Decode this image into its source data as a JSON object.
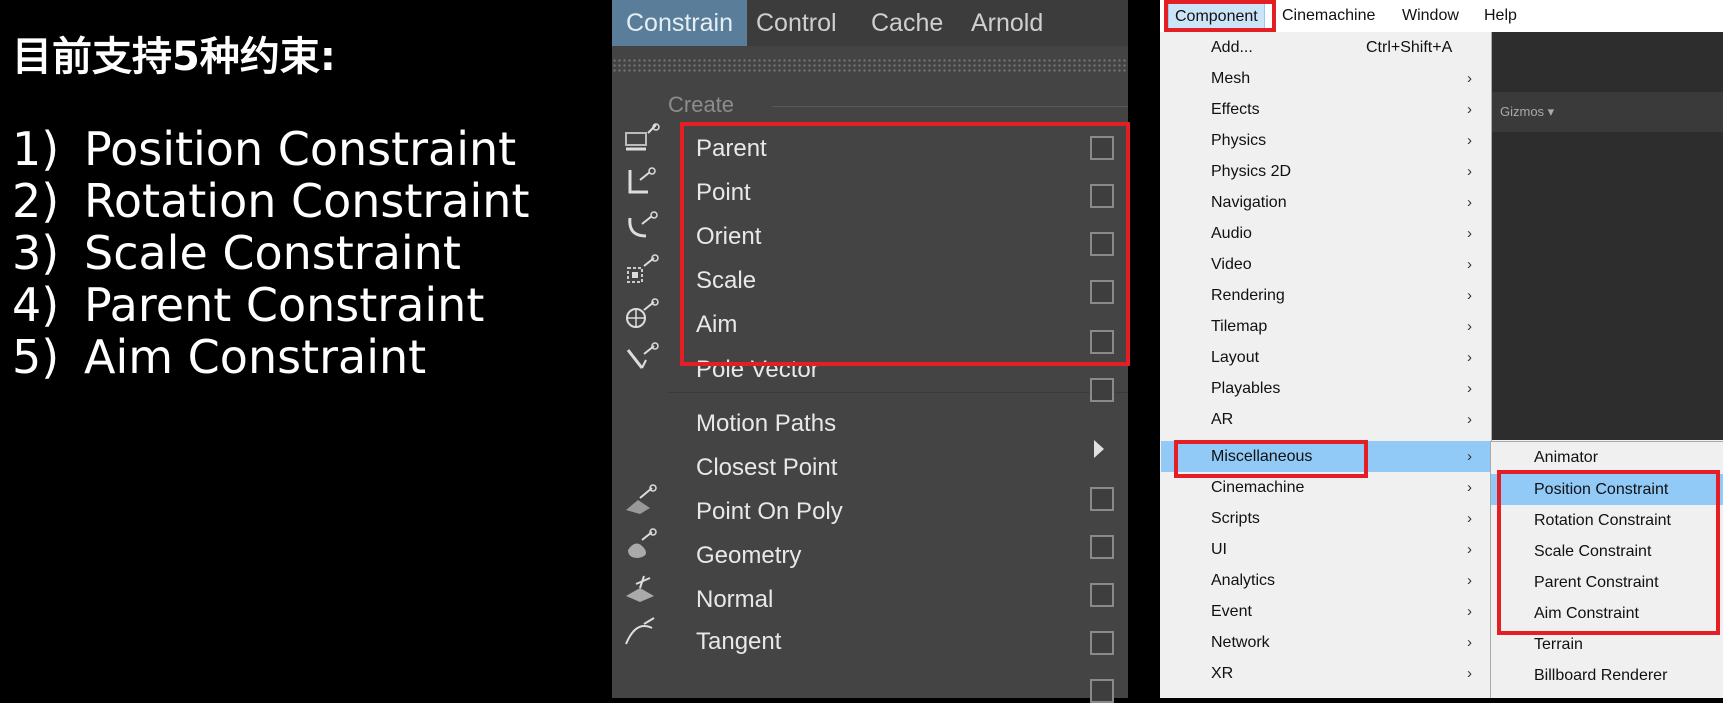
{
  "left": {
    "title": "目前支持5种约束:",
    "items": [
      {
        "num": "1)",
        "label": "Position Constraint"
      },
      {
        "num": "2)",
        "label": "Rotation Constraint"
      },
      {
        "num": "3)",
        "label": "Scale Constraint"
      },
      {
        "num": "4)",
        "label": "Parent Constraint"
      },
      {
        "num": "5)",
        "label": "Aim Constraint"
      }
    ]
  },
  "maya": {
    "tabs": [
      "Constrain",
      "Control",
      "Cache",
      "Arnold"
    ],
    "active_tab": "Constrain",
    "section_label": "Create",
    "items": [
      {
        "label": "Parent",
        "icon": "parent-constraint-icon"
      },
      {
        "label": "Point",
        "icon": "point-constraint-icon"
      },
      {
        "label": "Orient",
        "icon": "orient-constraint-icon"
      },
      {
        "label": "Scale",
        "icon": "scale-constraint-icon"
      },
      {
        "label": "Aim",
        "icon": "aim-constraint-icon"
      },
      {
        "label": "Pole Vector",
        "icon": "pole-vector-icon"
      },
      {
        "label": "Motion Paths",
        "icon": ""
      },
      {
        "label": "Closest Point",
        "icon": ""
      },
      {
        "label": "Point On Poly",
        "icon": "point-on-poly-icon"
      },
      {
        "label": "Geometry",
        "icon": "geometry-constraint-icon"
      },
      {
        "label": "Normal",
        "icon": "normal-constraint-icon"
      },
      {
        "label": "Tangent",
        "icon": "tangent-constraint-icon"
      }
    ],
    "colors": {
      "panel": "#444444",
      "active_tab": "#5a7e9a",
      "highlight": "#e31e24"
    }
  },
  "unity": {
    "menubar": [
      "Component",
      "Cinemachine",
      "Window",
      "Help"
    ],
    "active_menu": "Component",
    "scene_bar_text": "Gizmos ▾",
    "menu_items": [
      {
        "label": "Add...",
        "shortcut": "Ctrl+Shift+A",
        "submenu": false
      },
      {
        "label": "Mesh",
        "shortcut": "",
        "submenu": true
      },
      {
        "label": "Effects",
        "shortcut": "",
        "submenu": true
      },
      {
        "label": "Physics",
        "shortcut": "",
        "submenu": true
      },
      {
        "label": "Physics 2D",
        "shortcut": "",
        "submenu": true
      },
      {
        "label": "Navigation",
        "shortcut": "",
        "submenu": true
      },
      {
        "label": "Audio",
        "shortcut": "",
        "submenu": true
      },
      {
        "label": "Video",
        "shortcut": "",
        "submenu": true
      },
      {
        "label": "Rendering",
        "shortcut": "",
        "submenu": true
      },
      {
        "label": "Tilemap",
        "shortcut": "",
        "submenu": true
      },
      {
        "label": "Layout",
        "shortcut": "",
        "submenu": true
      },
      {
        "label": "Playables",
        "shortcut": "",
        "submenu": true
      },
      {
        "label": "AR",
        "shortcut": "",
        "submenu": true
      },
      {
        "label": "Miscellaneous",
        "shortcut": "",
        "submenu": true
      },
      {
        "label": "Cinemachine",
        "shortcut": "",
        "submenu": true
      },
      {
        "label": "Scripts",
        "shortcut": "",
        "submenu": true
      },
      {
        "label": "UI",
        "shortcut": "",
        "submenu": true
      },
      {
        "label": "Analytics",
        "shortcut": "",
        "submenu": true
      },
      {
        "label": "Event",
        "shortcut": "",
        "submenu": true
      },
      {
        "label": "Network",
        "shortcut": "",
        "submenu": true
      },
      {
        "label": "XR",
        "shortcut": "",
        "submenu": true
      }
    ],
    "highlighted_item": "Miscellaneous",
    "submenu_items": [
      "Animator",
      "Position Constraint",
      "Rotation Constraint",
      "Scale Constraint",
      "Parent Constraint",
      "Aim Constraint",
      "Terrain",
      "Billboard Renderer"
    ],
    "highlighted_sub": "Position Constraint",
    "arrow_glyph": "›",
    "colors": {
      "menu_bg": "#f0f0f0",
      "hover": "#91c9f7",
      "highlight": "#e31e24"
    }
  }
}
